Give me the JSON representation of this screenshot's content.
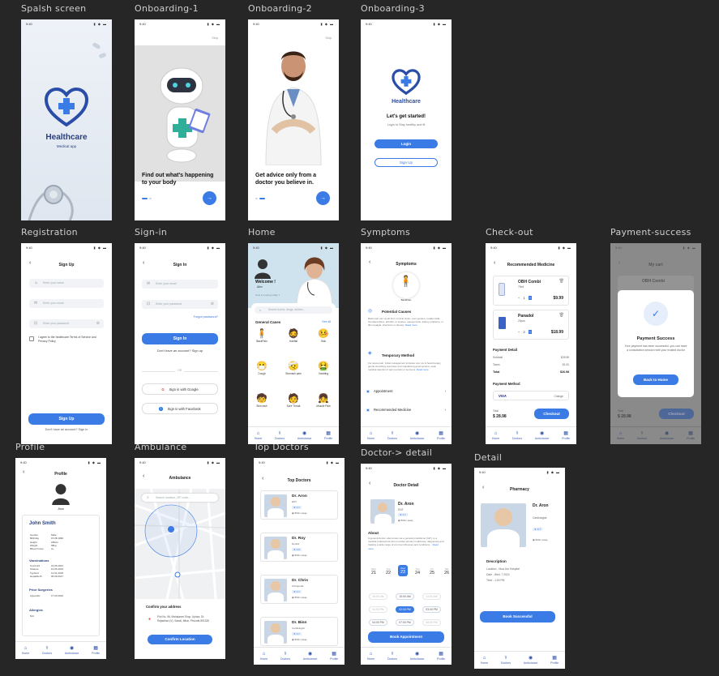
{
  "frames": {
    "splash": "Spalsh screen",
    "onb1": "Onboarding-1",
    "onb2": "Onboarding-2",
    "onb3": "Onboarding-3",
    "registration": "Registration",
    "signin": "Sign-in",
    "home": "Home",
    "symptoms": "Symptoms",
    "checkout": "Check-out",
    "payment": "Payment-success",
    "profile": "Profile",
    "ambulance": "Ambulance",
    "topdoctors": "Top Doctors",
    "doctordetail": "Doctor-> detail",
    "detail": "Detail"
  },
  "status": {
    "time": "9:40",
    "icons": "▮ ◆ ▬"
  },
  "splash": {
    "title": "Healthcare",
    "subtitle": "Medical app"
  },
  "onb1": {
    "skip": "Skip",
    "title": "Find out what's happening to your body",
    "next": "→"
  },
  "onb2": {
    "skip": "Skip",
    "title": "Get advice only from a doctor you believe in.",
    "next": "→"
  },
  "onb3": {
    "brand": "Healthcare",
    "title": "Let's get started!",
    "subtitle": "Login to Stay healthy and fit",
    "login": "Login",
    "signup": "Sign Up"
  },
  "registration": {
    "title": "Sign Up",
    "name_ph": "Enter your name",
    "email_ph": "Enter your email",
    "password_ph": "Enter your password",
    "agree": "I agree to the healthcare Terms of Service and Privacy Policy",
    "button": "Sign Up",
    "footer": "Don't have an account? Sign In"
  },
  "signin": {
    "title": "Sign In",
    "email_ph": "Enter your email",
    "password_ph": "Enter your password",
    "forgot": "Forgot password?",
    "button": "Sign In",
    "no_account": "Don't have an account? Sign up",
    "or": "OR",
    "google": "Sign in with Google",
    "facebook": "Sign in with Facebook"
  },
  "home": {
    "welcome": "Welcome !",
    "name": "Alex",
    "sub": "How is it going today ?",
    "search_ph": "Search doctor, drugs, articles...",
    "section": "General Cases",
    "see_all": "See all",
    "cases": [
      "BackPain",
      "Hairfall",
      "Sick",
      "Cough",
      "Stomach pain",
      "Vomiting",
      "Skin rash",
      "Sore Throat",
      "Muscle Pain"
    ]
  },
  "symptoms": {
    "title": "Symptoms",
    "chip": "BackPain",
    "causes_title": "Potential Causes",
    "causes_text": "Back pain can result from muscle strain, poor posture, sudden falls, herniated discs, arthritis, or injuries, osteoporosis, kidney problems, or fibromyalgia, infections or obesity.",
    "read_more": "Read more",
    "treat_title": "Temporary Method",
    "treat_text": "For acute pain, initial management includes rest, ice & heat therapy, gentle stretching exercises and maintaining good posture; seek medical attention if pain persists or worsens.",
    "appointment": "Appointment",
    "medicine": "Recommended Medicine"
  },
  "checkout": {
    "title": "Recommended Medicine",
    "items": [
      {
        "name": "OBH Combi",
        "size": "75ml",
        "qty": "1",
        "price": "$9.99"
      },
      {
        "name": "Panadol",
        "size": "20pcs",
        "qty": "2",
        "price": "$18.99"
      }
    ],
    "detail_title": "Payment Detail",
    "subtotal_label": "Subtotal",
    "subtotal": "$25.98",
    "taxes_label": "Taxes",
    "taxes": "$1.00",
    "total_label": "Total",
    "total": "$26.98",
    "method_title": "Payment Method",
    "card": "VISA",
    "change": "Change",
    "bottom_total_label": "Total",
    "bottom_total": "$ 28.98",
    "checkout": "Checkout"
  },
  "payment": {
    "bg_title": "My cart",
    "bg_item": "OBH Combi",
    "title": "Payment Success",
    "text": "Your payment has been successful, you can have a consultation session with your trusted doctor",
    "button": "Back to Home",
    "total_label": "Total",
    "total": "$ 28.98",
    "checkout": "Checkout"
  },
  "profile": {
    "title": "Profile",
    "small_name": "Jhon",
    "name": "John Smith",
    "info": [
      [
        "Gender",
        "Male"
      ],
      [
        "Birthday",
        "15.08.1996"
      ],
      [
        "Height",
        "180cm"
      ],
      [
        "Weight",
        "68kg"
      ],
      [
        "Blood Group",
        "A+"
      ]
    ],
    "vacc_title": "Vaccinations",
    "vacc": [
      [
        "Covid-19",
        "21.06.2021"
      ],
      [
        "Tetanus",
        "12.05.2019"
      ],
      [
        "Typhoid",
        "14.01.2018"
      ],
      [
        "Hepatitis B",
        "05.09.2017"
      ]
    ],
    "surg_title": "Prior Surgeries",
    "surg": [
      [
        "Appendix",
        "17.03.2010"
      ]
    ],
    "allergy_title": "Allergies",
    "allergy": "N/A"
  },
  "ambulance": {
    "title": "Ambulance",
    "search_ph": "Search location, ZIP code...",
    "confirm_title": "Confirm your address",
    "address": "Plot No. 56, Mahalaxmi Shop, Uplaur, Dt. Rajasthan (V), Sawai, Bihar, Pincode-891335",
    "button": "Confirm Location"
  },
  "topdoctors": {
    "title": "Top Doctors",
    "doctors": [
      {
        "name": "Dr. Aron",
        "spec": "ENT",
        "rating": "4.7",
        "dist": "800m away"
      },
      {
        "name": "Dr. Roy",
        "spec": "Dentist",
        "rating": "4.9",
        "dist": "800m away"
      },
      {
        "name": "Dr. Chris",
        "spec": "Orthopedic",
        "rating": "4.7",
        "dist": "800m away"
      },
      {
        "name": "Dr. Binn",
        "spec": "Cardiologist",
        "rating": "4.7",
        "dist": "800m away"
      }
    ]
  },
  "doctordetail": {
    "title": "Doctor Detail",
    "name": "Dr. Aron",
    "spec": "ENT",
    "rating": "4.7",
    "dist": "800m away",
    "about_title": "About",
    "about": "A general doctor, also known as a general practitioner (GP), is a medical professional who provides primary healthcare, diagnosing and treating a wide range of common illnesses and conditions...",
    "read_more": "Read more",
    "days": [
      [
        "Mon",
        "21"
      ],
      [
        "Tue",
        "22"
      ],
      [
        "Wed",
        "23"
      ],
      [
        "Thu",
        "24"
      ],
      [
        "Fri",
        "25"
      ],
      [
        "Sat",
        "26"
      ]
    ],
    "times": [
      "09:00 AM",
      "10:00 AM",
      "11:00 AM",
      "01:00 PM",
      "02:00 PM",
      "03:00 PM",
      "04:00 PM",
      "07:00 PM",
      "08:00 PM"
    ],
    "button": "Book Appointment"
  },
  "detail": {
    "title": "Pharmacy",
    "name": "Dr. Aron",
    "spec": "Cardiologist",
    "rating": "4.7",
    "dist": "800m away",
    "desc_title": "Description",
    "location": "Location - Mua Lim Hospital",
    "date": "Date - Wed, 7 2024",
    "time": "Time - 1:00 PM",
    "button": "Book Successful"
  },
  "nav": [
    "Home",
    "Doctors",
    "Ambulance",
    "Profile"
  ]
}
